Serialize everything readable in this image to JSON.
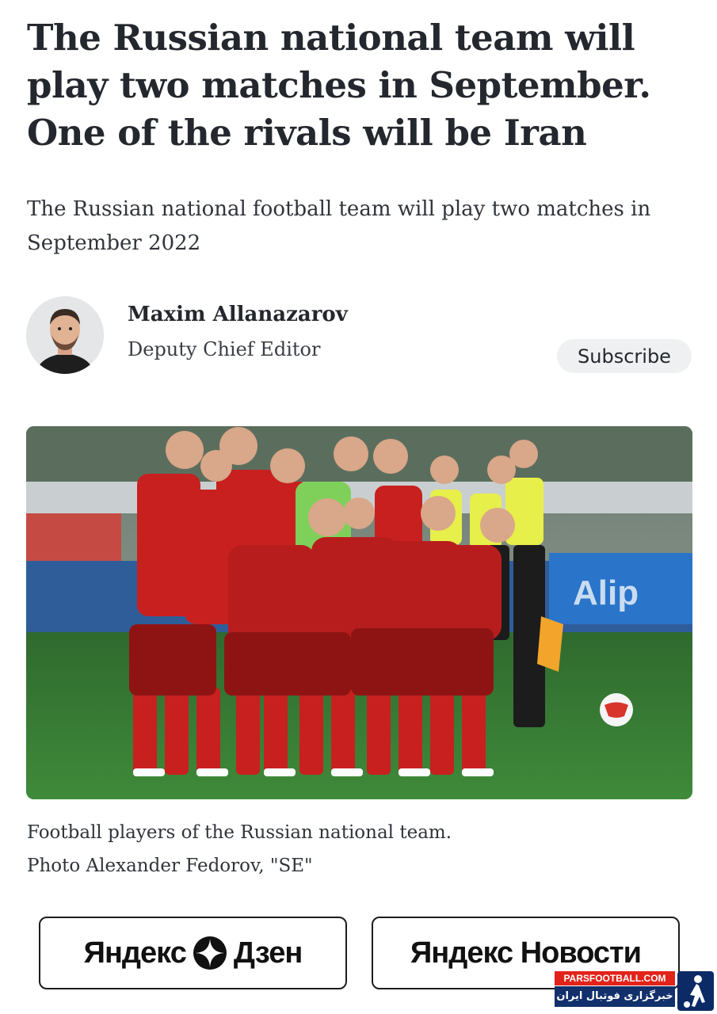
{
  "article": {
    "headline": "The Russian national team will play two matches in September. One of the rivals will be Iran",
    "lead": "The Russian national football team will play two matches in September 2022"
  },
  "author": {
    "name": "Maxim Allanazarov",
    "role": "Deputy Chief Editor",
    "subscribe_label": "Subscribe"
  },
  "photo": {
    "caption_line1": "Football players of the Russian national team.",
    "caption_line2": "Photo Alexander Fedorov, \"SE\""
  },
  "buttons": {
    "dzen_left": "Яндекс",
    "dzen_right": "Дзен",
    "news_label": "Яндекс Новости"
  },
  "watermark": {
    "top": "PARSFOOTBALL.COM",
    "bottom": "خبرگزاری فوتبال ایران"
  },
  "colors": {
    "text": "#24282e",
    "subscribe_bg": "#eef0f2",
    "kit_red": "#c8201f",
    "pitch_green": "#3c7a37"
  }
}
